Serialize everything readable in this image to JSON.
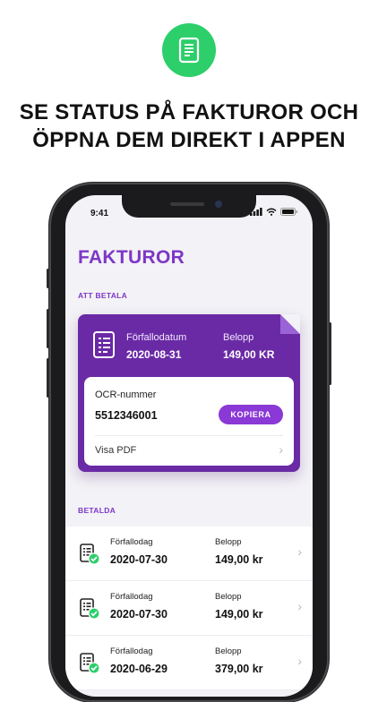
{
  "headline": {
    "line1": "SE STATUS PÅ FAKTUROR OCH",
    "line2": "ÖPPNA DEM DIREKT I APPEN"
  },
  "status": {
    "time": "9:41"
  },
  "page_title": "FAKTUROR",
  "to_pay": {
    "section_label": "ATT BETALA",
    "due_label": "Förfallodatum",
    "due_date": "2020-08-31",
    "amount_label": "Belopp",
    "amount": "149,00 KR",
    "ocr_label": "OCR-nummer",
    "ocr_number": "5512346001",
    "copy_label": "KOPIERA",
    "pdf_label": "Visa PDF"
  },
  "paid": {
    "section_label": "BETALDA",
    "items": [
      {
        "due_label": "Förfallodag",
        "due_date": "2020-07-30",
        "amount_label": "Belopp",
        "amount": "149,00 kr"
      },
      {
        "due_label": "Förfallodag",
        "due_date": "2020-07-30",
        "amount_label": "Belopp",
        "amount": "149,00 kr"
      },
      {
        "due_label": "Förfallodag",
        "due_date": "2020-06-29",
        "amount_label": "Belopp",
        "amount": "379,00 kr"
      }
    ]
  },
  "colors": {
    "accent": "#7d37c6",
    "card": "#6a2aa5",
    "button": "#8a38d6",
    "success": "#2ccf6a"
  },
  "icons": {
    "top": "invoice-icon",
    "card": "invoice-doc-icon",
    "paid": "paid-invoice-icon",
    "chevron": "chevron-right-icon"
  }
}
